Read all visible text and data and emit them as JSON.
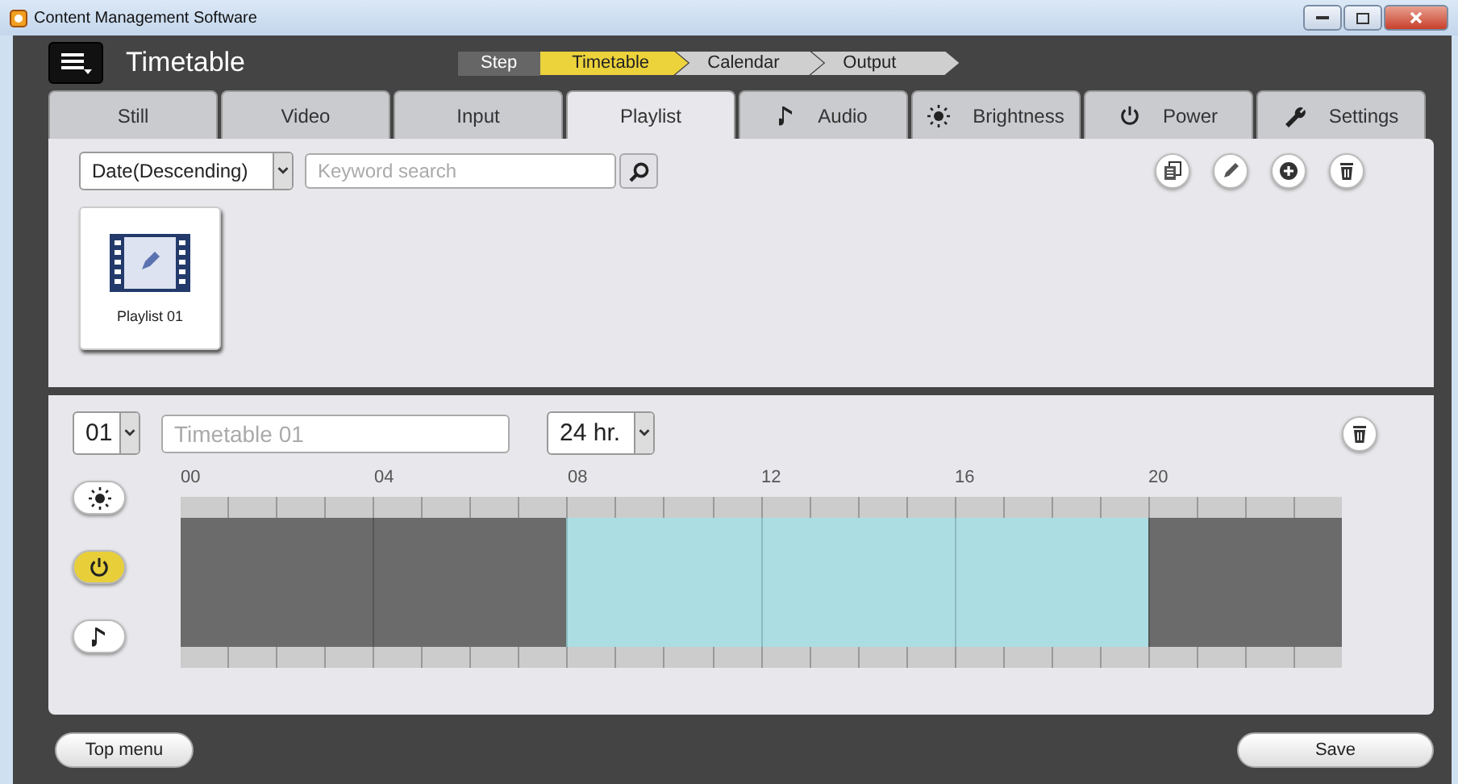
{
  "window": {
    "title": "Content Management Software"
  },
  "header": {
    "title": "Timetable"
  },
  "steps": {
    "label": "Step",
    "items": [
      {
        "label": "Timetable",
        "selected": true
      },
      {
        "label": "Calendar",
        "selected": false
      },
      {
        "label": "Output",
        "selected": false
      }
    ]
  },
  "tabs": [
    {
      "label": "Still",
      "kind": "plain",
      "selected": false
    },
    {
      "label": "Video",
      "kind": "plain",
      "selected": false
    },
    {
      "label": "Input",
      "kind": "plain",
      "selected": false
    },
    {
      "label": "Playlist",
      "kind": "plain",
      "selected": true
    },
    {
      "label": "Audio",
      "kind": "audio",
      "selected": false
    },
    {
      "label": "Brightness",
      "kind": "brightness",
      "selected": false
    },
    {
      "label": "Power",
      "kind": "power",
      "selected": false
    },
    {
      "label": "Settings",
      "kind": "settings",
      "selected": false
    }
  ],
  "playlist_panel": {
    "sort": "Date(Descending)",
    "search": {
      "placeholder": "Keyword search"
    },
    "items": [
      {
        "label": "Playlist 01"
      }
    ]
  },
  "timetable": {
    "number": "01",
    "name": {
      "placeholder": "Timetable 01"
    },
    "range": "24 hr.",
    "hour_labels": [
      "00",
      "04",
      "08",
      "12",
      "16",
      "20"
    ],
    "layers": [
      {
        "kind": "brightness",
        "selected": false
      },
      {
        "kind": "power",
        "selected": true
      },
      {
        "kind": "audio",
        "selected": false
      }
    ],
    "hours": [
      {
        "on": false
      },
      {
        "on": false
      },
      {
        "on": false
      },
      {
        "on": false
      },
      {
        "on": false
      },
      {
        "on": false
      },
      {
        "on": false
      },
      {
        "on": false
      },
      {
        "on": true
      },
      {
        "on": true
      },
      {
        "on": true
      },
      {
        "on": true
      },
      {
        "on": true
      },
      {
        "on": true
      },
      {
        "on": true
      },
      {
        "on": true
      },
      {
        "on": true
      },
      {
        "on": true
      },
      {
        "on": true
      },
      {
        "on": true
      },
      {
        "on": false
      },
      {
        "on": false
      },
      {
        "on": false
      },
      {
        "on": false
      }
    ]
  },
  "footer": {
    "buttons": [
      "Top menu",
      "Save"
    ]
  }
}
